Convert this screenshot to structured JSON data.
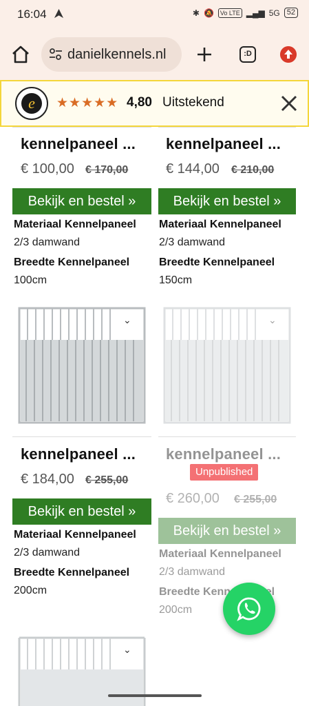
{
  "status_bar": {
    "time": "16:04",
    "network": "5G",
    "volte": "Vo LTE",
    "battery": "52"
  },
  "browser": {
    "url": "danielkennels.nl",
    "tabs_label": ":D"
  },
  "trust_bar": {
    "stars": "★★★★★",
    "score": "4,80",
    "label": "Uitstekend",
    "logo_letter": "e"
  },
  "products": [
    {
      "title": "kennelpaneel ...",
      "price": "€ 100,00",
      "old_price": "€ 170,00",
      "button": "Bekijk en bestel »",
      "attr1_label": "Materiaal Kennelpaneel",
      "attr1_value": "2/3 damwand",
      "attr2_label": "Breedte Kennelpaneel",
      "attr2_value": "100cm"
    },
    {
      "title": "kennelpaneel ...",
      "price": "€ 144,00",
      "old_price": "€ 210,00",
      "button": "Bekijk en bestel »",
      "attr1_label": "Materiaal Kennelpaneel",
      "attr1_value": "2/3 damwand",
      "attr2_label": "Breedte Kennelpaneel",
      "attr2_value": "150cm"
    },
    {
      "title": "kennelpaneel ...",
      "price": "€ 184,00",
      "old_price": "€ 255,00",
      "button": "Bekijk en bestel »",
      "attr1_label": "Materiaal Kennelpaneel",
      "attr1_value": "2/3 damwand",
      "attr2_label": "Breedte Kennelpaneel",
      "attr2_value": "200cm"
    },
    {
      "title": "kennelpaneel ...",
      "badge": "Unpublished",
      "price": "€ 260,00",
      "old_price": "€ 255,00",
      "button": "Bekijk en bestel »",
      "attr1_label": "Materiaal Kennelpaneel",
      "attr1_value": "2/3 damwand",
      "attr2_label": "Breedte Kennelpaneel",
      "attr2_value": "200cm"
    }
  ],
  "colors": {
    "button_green": "#2f7d23",
    "badge_red": "#f47174",
    "whatsapp": "#25d366",
    "stars": "#d96c25"
  }
}
